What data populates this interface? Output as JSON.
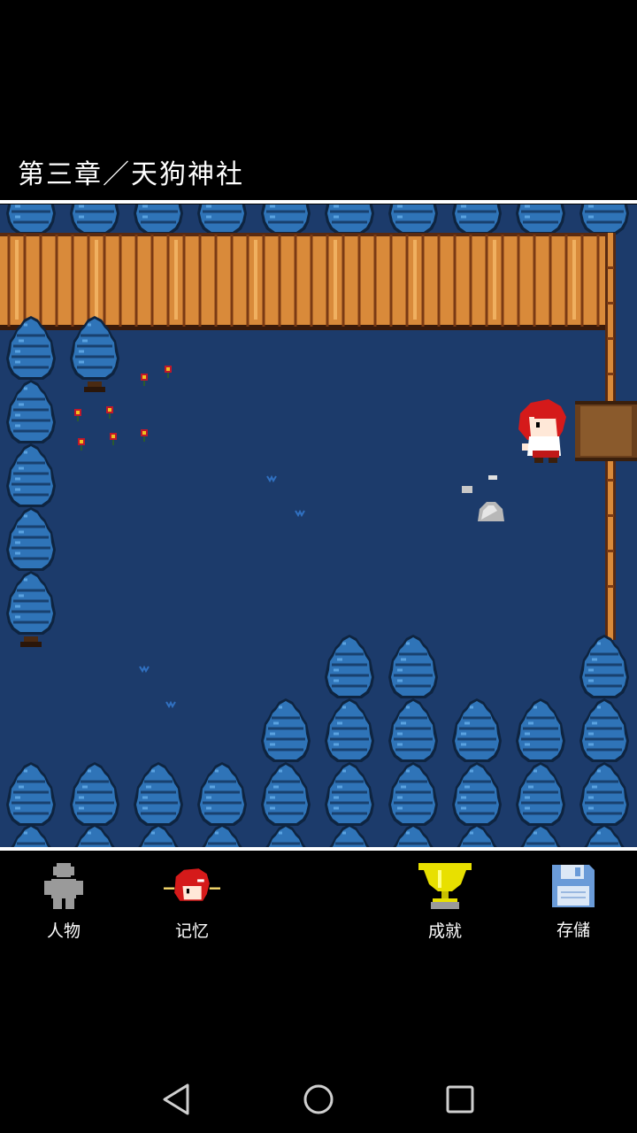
{
  "chapter": {
    "title": "第三章／天狗神社"
  },
  "toolbar": {
    "characters_label": "人物",
    "memory_label": "记忆",
    "achievements_label": "成就",
    "save_label": "存儲"
  },
  "colors": {
    "ground": "#1c3b6b",
    "tree": "#2f74b8",
    "tree_dark": "#18416f",
    "fence": "#d98a3a",
    "hair_red": "#d51a1a",
    "trophy": "#e8e000",
    "floppy": "#6a9bd8"
  },
  "icons": {
    "characters": "person-silhouette-icon",
    "memory": "red-hair-girl-icon",
    "achievements": "trophy-icon",
    "save": "floppy-disk-icon",
    "back": "back-triangle-icon",
    "home": "home-circle-icon",
    "recents": "recents-square-icon"
  }
}
